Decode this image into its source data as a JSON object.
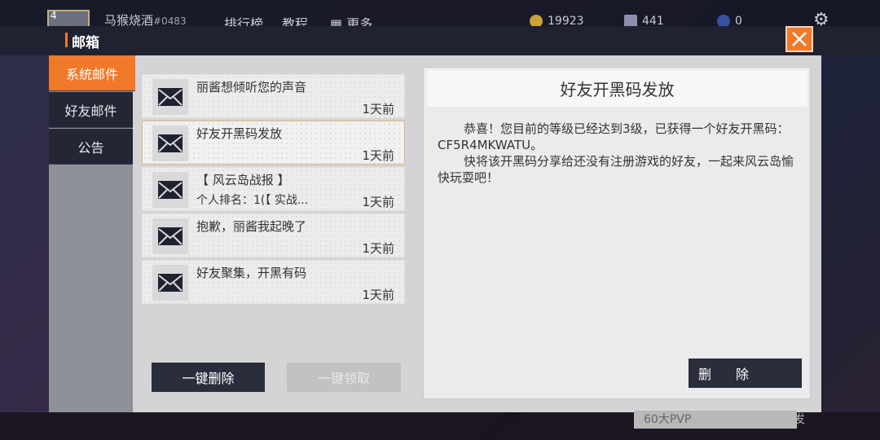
{
  "background": {
    "player_level": "4",
    "player_name": "马猴烧酒",
    "player_id": "#0483",
    "nav": [
      "排行榜",
      "教程",
      "更多"
    ],
    "gold": "19923",
    "gems": "441",
    "tickets": "0",
    "pvp_label": "60大PVP",
    "start_label": "出发"
  },
  "window": {
    "title": "邮箱",
    "close_icon": "close-icon"
  },
  "tabs": [
    {
      "label": "系统邮件",
      "active": true
    },
    {
      "label": "好友邮件",
      "active": false
    },
    {
      "label": "公告",
      "active": false
    }
  ],
  "mails": [
    {
      "subject": "丽酱想倾听您的声音",
      "preview": "",
      "time": "1天前",
      "selected": false
    },
    {
      "subject": "好友开黑码发放",
      "preview": "",
      "time": "1天前",
      "selected": true
    },
    {
      "subject": "【 风云岛战报 】",
      "preview": "个人排名：1(【 实战...",
      "time": "1天前",
      "selected": false
    },
    {
      "subject": "抱歉，丽酱我起晚了",
      "preview": "",
      "time": "1天前",
      "selected": false
    },
    {
      "subject": "好友聚集，开黑有码",
      "preview": "",
      "time": "1天前",
      "selected": false
    }
  ],
  "buttons": {
    "delete_all": "一键删除",
    "claim_all": "一键领取",
    "delete": "删除"
  },
  "detail": {
    "title": "好友开黑码发放",
    "paragraph1": "恭喜！您目前的等级已经达到3级，已获得一个好友开黑码：CF5R4MKWATU。",
    "paragraph2": "快将该开黑码分享给还没有注册游戏的好友，一起来风云岛愉快玩耍吧！"
  },
  "colors": {
    "accent": "#f07a2a",
    "dark_button": "#2a2d3b",
    "panel": "#d4d4d6"
  }
}
